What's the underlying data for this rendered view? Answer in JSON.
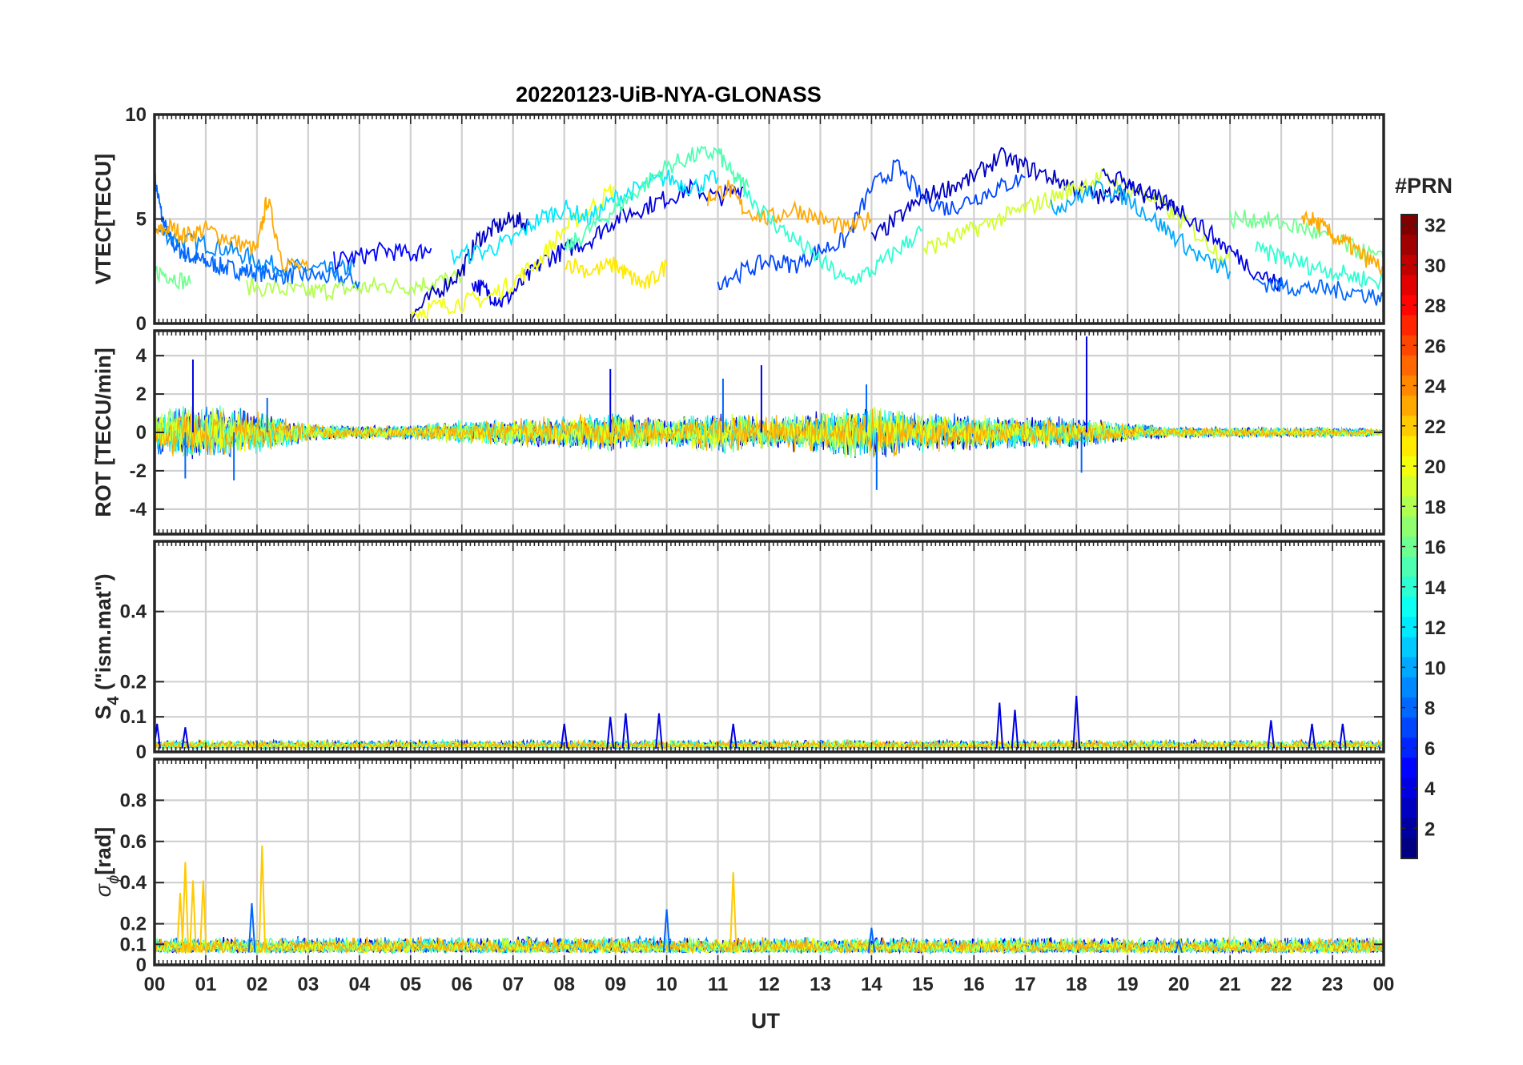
{
  "title": "20220123-UiB-NYA-GLONASS",
  "x_axis": {
    "label": "UT",
    "tick_labels": [
      "00",
      "01",
      "02",
      "03",
      "04",
      "05",
      "06",
      "07",
      "08",
      "09",
      "10",
      "11",
      "12",
      "13",
      "14",
      "15",
      "16",
      "17",
      "18",
      "19",
      "20",
      "21",
      "22",
      "23",
      "00"
    ]
  },
  "colorbar": {
    "label": "#PRN",
    "tick_labels": [
      "32",
      "30",
      "28",
      "26",
      "24",
      "22",
      "20",
      "18",
      "16",
      "14",
      "12",
      "10",
      "8",
      "6",
      "4",
      "2"
    ]
  },
  "panels": [
    {
      "id": "vtec",
      "ylabel": "VTEC[TECU]",
      "tick_labels": [
        "0",
        "5",
        "10"
      ]
    },
    {
      "id": "rot",
      "ylabel": "ROT [TECU/min]",
      "tick_labels": [
        "-4",
        "-2",
        "0",
        "2",
        "4"
      ]
    },
    {
      "id": "s4",
      "ylabel_main": "S",
      "ylabel_sub": "4",
      "ylabel_rest": " (\"ism.mat\")",
      "tick_labels": [
        "0",
        "0.1",
        "0.2",
        "0.4"
      ]
    },
    {
      "id": "sigma",
      "ylabel_main": "σ",
      "ylabel_sub": "ϕ",
      "ylabel_rest": "[rad]",
      "tick_labels": [
        "0",
        "0.1",
        "0.2",
        "0.4",
        "0.6",
        "0.8"
      ]
    }
  ],
  "chart_data": [
    {
      "type": "line",
      "title": "20220123-UiB-NYA-GLONASS",
      "xlabel": "UT",
      "ylabel": "VTEC[TECU]",
      "xlim": [
        0,
        24
      ],
      "ylim": [
        0,
        10
      ],
      "yticks": [
        0,
        5,
        10
      ],
      "grid": true,
      "color_by": "PRN (colorbar 1-32, jet)",
      "series": [
        {
          "prn": 8,
          "x": [
            0.0,
            0.15,
            0.3,
            0.5,
            0.7,
            0.9,
            1.2,
            1.5,
            1.8,
            2.2,
            2.6,
            3.0,
            3.5,
            4.0
          ],
          "y": [
            7.0,
            5.0,
            4.0,
            3.5,
            3.2,
            3.0,
            2.8,
            2.6,
            2.5,
            2.4,
            2.3,
            2.3,
            2.2,
            2.0
          ]
        },
        {
          "prn": 9,
          "x": [
            0.0,
            0.5,
            1.0,
            1.5,
            2.0,
            2.5,
            3.0,
            3.5,
            3.9
          ],
          "y": [
            4.5,
            4.0,
            3.8,
            3.5,
            3.0,
            2.7,
            2.6,
            2.5,
            2.7
          ]
        },
        {
          "prn": 23,
          "x": [
            0.0,
            0.3,
            0.6,
            1.0,
            1.5,
            2.0,
            2.2,
            2.5,
            3.0
          ],
          "y": [
            4.3,
            4.6,
            4.2,
            4.5,
            4.0,
            3.5,
            6.0,
            3.0,
            2.5
          ]
        },
        {
          "prn": 16,
          "x": [
            0.0,
            0.3,
            0.7
          ],
          "y": [
            2.5,
            2.3,
            1.9
          ]
        },
        {
          "prn": 18,
          "x": [
            1.8,
            2.5,
            3.0,
            3.5,
            4.0,
            4.5,
            5.0,
            5.5,
            6.0
          ],
          "y": [
            1.8,
            1.6,
            1.5,
            1.6,
            1.7,
            1.8,
            1.8,
            2.0,
            2.2
          ]
        },
        {
          "prn": 5,
          "x": [
            3.5,
            4.0,
            4.5,
            5.0,
            5.4
          ],
          "y": [
            3.0,
            3.2,
            3.5,
            3.3,
            3.6
          ]
        },
        {
          "prn": 3,
          "x": [
            5.0,
            5.5,
            6.0,
            6.3,
            6.6,
            7.0,
            7.3
          ],
          "y": [
            0.3,
            1.5,
            2.5,
            4.0,
            4.5,
            5.0,
            4.7
          ]
        },
        {
          "prn": 4,
          "x": [
            6.2,
            6.5,
            6.8,
            7.2,
            7.6,
            8.0,
            8.5,
            9.0,
            9.5,
            10.0,
            10.5,
            11.0,
            11.5
          ],
          "y": [
            2.0,
            1.5,
            1.0,
            2.0,
            3.0,
            3.5,
            4.0,
            5.0,
            5.5,
            6.0,
            6.5,
            6.0,
            6.5
          ]
        },
        {
          "prn": 20,
          "x": [
            5.0,
            5.5,
            6.0,
            6.5,
            7.0,
            7.5,
            8.0,
            8.5,
            9.0
          ],
          "y": [
            0.5,
            0.8,
            1.0,
            1.2,
            2.0,
            3.0,
            4.5,
            5.5,
            6.5
          ]
        },
        {
          "prn": 12,
          "x": [
            5.8,
            6.5,
            7.0,
            7.5,
            8.0,
            8.5,
            9.0,
            9.5,
            10.0,
            10.5,
            11.0
          ],
          "y": [
            3.2,
            3.5,
            4.0,
            5.0,
            5.5,
            5.0,
            6.0,
            6.5,
            7.0,
            6.5,
            7.0
          ]
        },
        {
          "prn": 15,
          "x": [
            8.0,
            8.5,
            9.0,
            9.5,
            10.0,
            10.5,
            11.0,
            11.3,
            11.6
          ],
          "y": [
            3.5,
            4.5,
            5.5,
            6.5,
            7.5,
            8.0,
            8.2,
            7.0,
            6.5
          ]
        },
        {
          "prn": 21,
          "x": [
            8.0,
            8.5,
            9.0,
            9.3,
            9.6,
            10.0
          ],
          "y": [
            3.0,
            2.5,
            2.8,
            2.2,
            1.8,
            2.8
          ]
        },
        {
          "prn": 7,
          "x": [
            11.0,
            11.5,
            12.0,
            12.5,
            13.0,
            13.5,
            14.0,
            14.5,
            15.0,
            15.5,
            16.0,
            16.5,
            17.0
          ],
          "y": [
            2.0,
            2.5,
            3.0,
            2.8,
            3.5,
            4.0,
            6.5,
            7.5,
            6.0,
            5.5,
            6.0,
            6.5,
            7.0
          ]
        },
        {
          "prn": 23,
          "x": [
            10.8,
            11.2,
            11.5,
            12.0,
            12.5,
            13.0,
            13.5,
            14.0
          ],
          "y": [
            6.0,
            6.5,
            5.5,
            5.0,
            5.5,
            5.0,
            4.5,
            5.0
          ]
        },
        {
          "prn": 14,
          "x": [
            11.5,
            12.0,
            12.5,
            13.0,
            13.5,
            14.0,
            14.5,
            15.0
          ],
          "y": [
            6.5,
            5.0,
            4.0,
            3.0,
            2.0,
            2.5,
            3.5,
            4.5
          ]
        },
        {
          "prn": 3,
          "x": [
            14.0,
            14.5,
            15.0,
            15.5,
            16.0,
            16.5,
            17.0,
            17.5,
            18.0,
            18.5,
            19.0,
            19.5,
            20.0
          ],
          "y": [
            4.0,
            5.0,
            6.0,
            6.5,
            7.0,
            8.0,
            7.5,
            7.0,
            6.5,
            6.0,
            6.5,
            6.0,
            5.5
          ]
        },
        {
          "prn": 19,
          "x": [
            15.0,
            15.5,
            16.0,
            16.5,
            17.0,
            17.5,
            18.0,
            18.5,
            19.0,
            19.5,
            20.0,
            20.5,
            21.0
          ],
          "y": [
            3.5,
            4.0,
            4.5,
            5.0,
            5.5,
            6.0,
            6.5,
            7.0,
            6.5,
            6.0,
            5.0,
            4.0,
            3.0
          ]
        },
        {
          "prn": 10,
          "x": [
            17.5,
            18.0,
            18.5,
            19.0,
            19.5,
            20.0,
            20.5,
            21.0
          ],
          "y": [
            5.5,
            6.0,
            6.5,
            6.0,
            5.0,
            4.0,
            3.0,
            2.5
          ]
        },
        {
          "prn": 4,
          "x": [
            18.5,
            19.0,
            19.5,
            20.0,
            20.5,
            21.0,
            21.5,
            22.0
          ],
          "y": [
            7.0,
            6.8,
            6.0,
            5.5,
            4.5,
            3.5,
            2.5,
            1.8
          ]
        },
        {
          "prn": 8,
          "x": [
            21.5,
            22.0,
            22.5,
            23.0,
            23.5,
            24.0
          ],
          "y": [
            2.0,
            1.8,
            1.7,
            1.6,
            1.5,
            1.2
          ]
        },
        {
          "prn": 16,
          "x": [
            21.0,
            21.5,
            22.0,
            22.5,
            23.0,
            23.5,
            24.0
          ],
          "y": [
            5.0,
            5.0,
            4.8,
            4.5,
            4.0,
            3.5,
            3.0
          ]
        },
        {
          "prn": 23,
          "x": [
            22.4,
            22.7,
            23.0,
            23.3,
            23.6,
            24.0
          ],
          "y": [
            5.2,
            4.8,
            4.2,
            3.8,
            3.2,
            2.6
          ]
        },
        {
          "prn": 14,
          "x": [
            21.5,
            22.0,
            22.5,
            23.0,
            23.5,
            24.0
          ],
          "y": [
            3.5,
            3.2,
            2.8,
            2.5,
            2.2,
            2.0
          ]
        }
      ]
    },
    {
      "type": "line",
      "ylabel": "ROT [TECU/min]",
      "xlabel": "UT",
      "xlim": [
        0,
        24
      ],
      "ylim": [
        -5.3,
        5.3
      ],
      "yticks": [
        -4,
        -2,
        0,
        2,
        4
      ],
      "grid": true,
      "color_by": "PRN (colorbar 1-32, jet)",
      "envelope": {
        "x": [
          0,
          1,
          2,
          3,
          4,
          5,
          6,
          7,
          8,
          9,
          10,
          11,
          12,
          13,
          14,
          15,
          16,
          17,
          18,
          19,
          20,
          21,
          22,
          23,
          24
        ],
        "amplitude": [
          1.2,
          1.6,
          1.2,
          0.5,
          0.4,
          0.4,
          0.7,
          0.8,
          0.9,
          1.1,
          0.8,
          1.2,
          1.0,
          1.2,
          1.5,
          1.1,
          1.0,
          0.9,
          0.9,
          0.5,
          0.3,
          0.3,
          0.3,
          0.3,
          0.2
        ]
      },
      "spikes": [
        {
          "x": 0.75,
          "y": 3.8
        },
        {
          "x": 0.6,
          "y": -2.4
        },
        {
          "x": 1.55,
          "y": -2.5
        },
        {
          "x": 2.2,
          "y": 1.8
        },
        {
          "x": 8.9,
          "y": 3.3
        },
        {
          "x": 11.1,
          "y": 2.8
        },
        {
          "x": 11.85,
          "y": 3.5
        },
        {
          "x": 13.9,
          "y": 2.5
        },
        {
          "x": 14.1,
          "y": -3.0
        },
        {
          "x": 18.2,
          "y": 5.0
        },
        {
          "x": 18.1,
          "y": -2.1
        }
      ]
    },
    {
      "type": "line",
      "ylabel": "S4 (\"ism.mat\")",
      "xlabel": "UT",
      "xlim": [
        0,
        24
      ],
      "ylim": [
        0,
        0.6
      ],
      "yticks": [
        0,
        0.1,
        0.2,
        0.4
      ],
      "grid": true,
      "color_by": "PRN (colorbar 1-32, jet)",
      "baseline": 0.01,
      "spikes": [
        {
          "x": 0.05,
          "y": 0.08
        },
        {
          "x": 0.6,
          "y": 0.07
        },
        {
          "x": 8.0,
          "y": 0.08
        },
        {
          "x": 8.9,
          "y": 0.1
        },
        {
          "x": 9.2,
          "y": 0.11
        },
        {
          "x": 9.85,
          "y": 0.11
        },
        {
          "x": 11.3,
          "y": 0.08
        },
        {
          "x": 16.5,
          "y": 0.14
        },
        {
          "x": 16.8,
          "y": 0.12
        },
        {
          "x": 18.0,
          "y": 0.16
        },
        {
          "x": 21.8,
          "y": 0.09
        },
        {
          "x": 22.6,
          "y": 0.08
        },
        {
          "x": 23.2,
          "y": 0.08
        }
      ]
    },
    {
      "type": "line",
      "ylabel": "σϕ[rad]",
      "xlabel": "UT",
      "xlim": [
        0,
        24
      ],
      "ylim": [
        0,
        1.0
      ],
      "yticks": [
        0,
        0.1,
        0.2,
        0.4,
        0.6,
        0.8
      ],
      "grid": true,
      "color_by": "PRN (colorbar 1-32, jet)",
      "baseline": 0.06,
      "spikes": [
        {
          "x": 0.5,
          "y": 0.35
        },
        {
          "x": 0.6,
          "y": 0.5
        },
        {
          "x": 0.75,
          "y": 0.41
        },
        {
          "x": 0.95,
          "y": 0.41
        },
        {
          "x": 2.1,
          "y": 0.58
        },
        {
          "x": 1.9,
          "y": 0.3
        },
        {
          "x": 10.0,
          "y": 0.27
        },
        {
          "x": 11.3,
          "y": 0.45
        },
        {
          "x": 14.0,
          "y": 0.18
        },
        {
          "x": 20.0,
          "y": 0.12
        }
      ]
    }
  ]
}
